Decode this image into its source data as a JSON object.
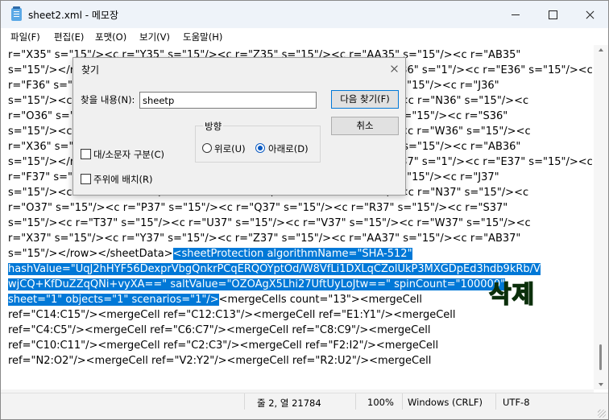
{
  "window": {
    "title": "sheet2.xml - 메모장",
    "icon": "notepad-icon",
    "controls": [
      "minimize-icon",
      "maximize-icon",
      "close-icon"
    ]
  },
  "menu": [
    "파일(F)",
    "편집(E)",
    "포맷(O)",
    "보기(V)",
    "도움말(H)"
  ],
  "editor": {
    "lines": [
      "r=\"X35\" s=\"15\"/><c r=\"Y35\" s=\"15\"/><c r=\"Z35\" s=\"15\"/><c r=\"AA35\" s=\"15\"/><c r=\"AB35\"",
      "s=\"15\"/></row><row r=\"36\" spans=\"1:28\"><c r=\"A36\" s=\"1\"/><c r=\"D36\" s=\"1\"/><c r=\"E36\" s=\"15\"/><c",
      "r=\"F36\" s=\"15\"/><c r=\"G36\" s=\"15\"/><c r=\"H36\" s=\"15\"/><c r=\"I36\" s=\"15\"/><c r=\"J36\"",
      "s=\"15\"/><c r=\"K36\" s=\"15\"/><c r=\"L36\" s=\"15\"/><c r=\"M36\" s=\"15\"/><c r=\"N36\" s=\"15\"/><c",
      "r=\"O36\" s=\"15\"/><c r=\"P36\" s=\"15\"/><c r=\"Q36\" s=\"15\"/><c r=\"R36\" s=\"15\"/><c r=\"S36\"",
      "s=\"15\"/><c r=\"T36\" s=\"15\"/><c r=\"U36\" s=\"15\"/><c r=\"V36\" s=\"15\"/><c r=\"W36\" s=\"15\"/><c",
      "r=\"X36\" s=\"15\"/><c r=\"Y36\" s=\"15\"/><c r=\"Z36\" s=\"15\"/><c r=\"AA36\" s=\"15\"/><c r=\"AB36\"",
      "s=\"15\"/></row><row r=\"37\" spans=\"1:28\"><c r=\"A37\" s=\"1\"/><c r=\"D37\" s=\"1\"/><c r=\"E37\" s=\"15\"/><c",
      "r=\"F37\" s=\"15\"/><c r=\"G37\" s=\"15\"/><c r=\"H37\" s=\"15\"/><c r=\"I37\" s=\"15\"/><c r=\"J37\"",
      "s=\"15\"/><c r=\"K37\" s=\"15\"/><c r=\"L37\" s=\"15\"/><c r=\"M37\" s=\"15\"/><c r=\"N37\" s=\"15\"/><c",
      "r=\"O37\" s=\"15\"/><c r=\"P37\" s=\"15\"/><c r=\"Q37\" s=\"15\"/><c r=\"R37\" s=\"15\"/><c r=\"S37\"",
      "s=\"15\"/><c r=\"T37\" s=\"15\"/><c r=\"U37\" s=\"15\"/><c r=\"V37\" s=\"15\"/><c r=\"W37\" s=\"15\"/><c",
      "r=\"X37\" s=\"15\"/><c r=\"Y37\" s=\"15\"/><c r=\"Z37\" s=\"15\"/><c r=\"AA37\" s=\"15\"/><c r=\"AB37\""
    ],
    "line_13_plain": "s=\"15\"/></row></sheetData>",
    "selection": [
      "<sheetProtection algorithmName=\"SHA-512\"",
      "hashValue=\"UqJ2hHYF56DexprVbgQnkrPCqERQOYptOd/W8VfLi1DXLqCZolUkP3MXGDpEd3hdb9kRb/V",
      "wjCQ+KfDuZZqQNi+vyXA==\" saltValue=\"OZOAgX5Lhi27UftUyLoJtw==\" spinCount=\"100000\"",
      "sheet=\"1\" objects=\"1\" scenarios=\"1\"/>"
    ],
    "line_16_after": "<mergeCells count=\"13\"><mergeCell",
    "tail_lines": [
      "ref=\"C14:C15\"/><mergeCell ref=\"C12:C13\"/><mergeCell ref=\"E1:Y1\"/><mergeCell",
      "ref=\"C4:C5\"/><mergeCell ref=\"C6:C7\"/><mergeCell ref=\"C8:C9\"/><mergeCell",
      "ref=\"C10:C11\"/><mergeCell ref=\"C2:C3\"/><mergeCell ref=\"F2:I2\"/><mergeCell",
      "ref=\"N2:O2\"/><mergeCell ref=\"V2:Y2\"/><mergeCell ref=\"R2:U2\"/><mergeCell"
    ],
    "overlay_label": "삭제",
    "overlay_color": "#32e234",
    "selection_color": "#0078d7"
  },
  "status": {
    "position": "줄 2, 열 21784",
    "zoom": "100%",
    "line_ending": "Windows (CRLF)",
    "encoding": "UTF-8"
  },
  "find_dialog": {
    "title": "찾기",
    "find_label": "찾을 내용(N):",
    "find_value": "sheetp",
    "find_next": "다음 찾기(F)",
    "cancel": "취소",
    "direction_label": "방향",
    "up_label": "위로(U)",
    "down_label": "아래로(D)",
    "direction_selected": "down",
    "match_case": "대/소문자 구분(C)",
    "wrap_around": "주위에 배치(R)"
  }
}
